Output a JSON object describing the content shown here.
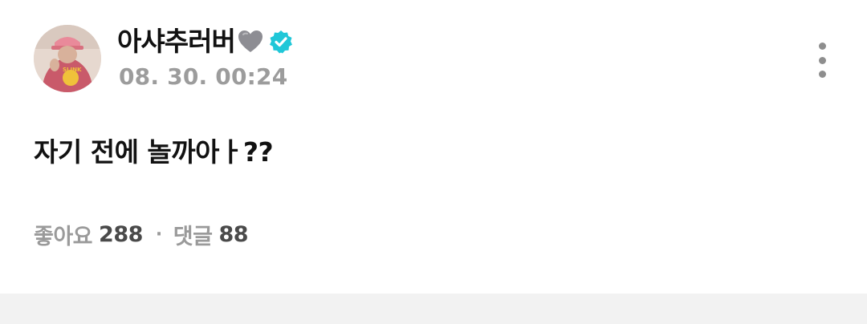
{
  "post": {
    "author": {
      "name": "아샤추러버",
      "heart_icon": "grey-heart-icon",
      "verified_icon": "verified-badge-icon",
      "verified_color": "#20c7d8"
    },
    "timestamp": "08. 30. 00:24",
    "more_icon": "more-vertical-icon",
    "text": "자기 전에 놀까아ㅏ??",
    "stats": {
      "likes_label": "좋아요",
      "likes_count": "288",
      "separator": "·",
      "comments_label": "댓글",
      "comments_count": "88"
    }
  }
}
